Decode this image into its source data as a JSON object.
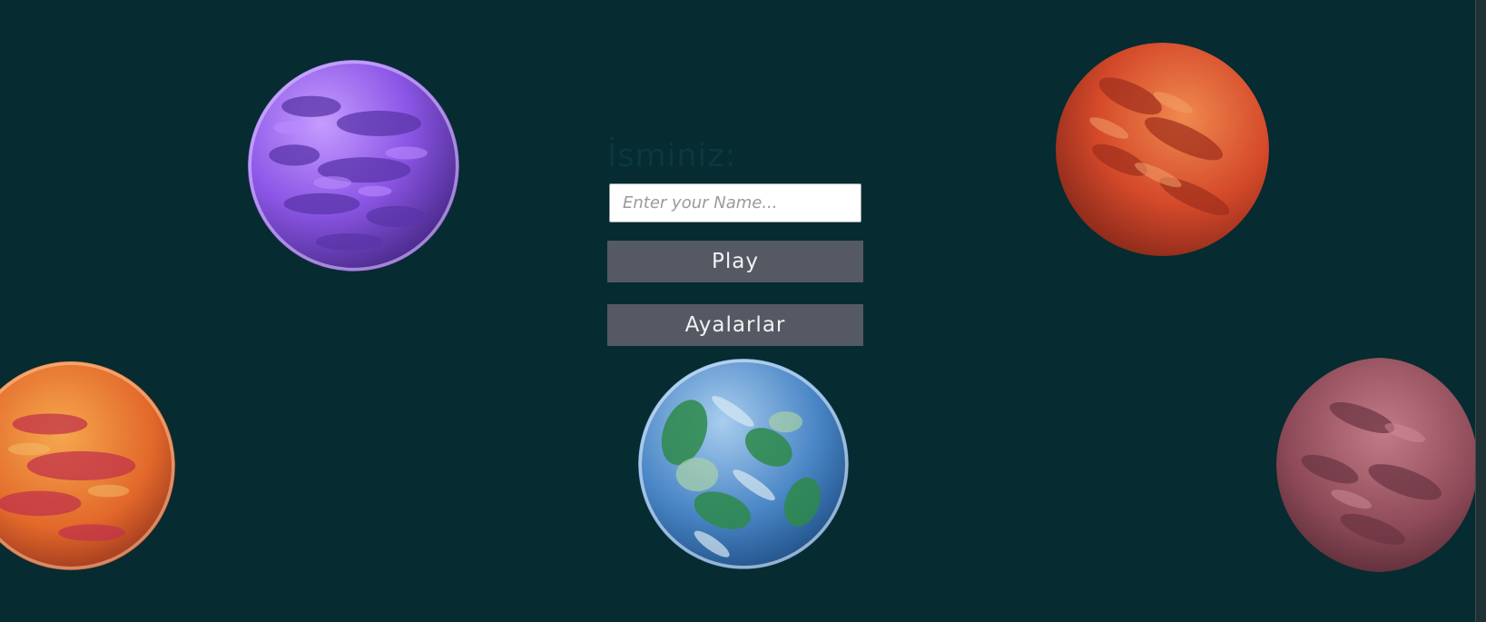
{
  "menu": {
    "name_label": "İsminiz:",
    "name_placeholder": "Enter your Name...",
    "name_value": "",
    "play_label": "Play",
    "settings_label": "Ayalarlar"
  },
  "theme": {
    "background": "#062b30",
    "button_color": "#555964",
    "label_color": "#0b3840"
  },
  "planets": [
    {
      "name": "purple-planet",
      "colors": [
        "#9d63f0",
        "#6a3fc0",
        "#c59cff"
      ]
    },
    {
      "name": "red-planet",
      "colors": [
        "#d9502c",
        "#9e2e1c",
        "#f0894e"
      ]
    },
    {
      "name": "orange-planet",
      "colors": [
        "#ef7f2a",
        "#c2334a",
        "#f3a64e"
      ]
    },
    {
      "name": "earth-planet",
      "colors": [
        "#4f8fd0",
        "#2e8a4a",
        "#b9d7ea"
      ]
    },
    {
      "name": "mauve-planet",
      "colors": [
        "#9a5362",
        "#6a3440",
        "#c27a88"
      ]
    }
  ]
}
